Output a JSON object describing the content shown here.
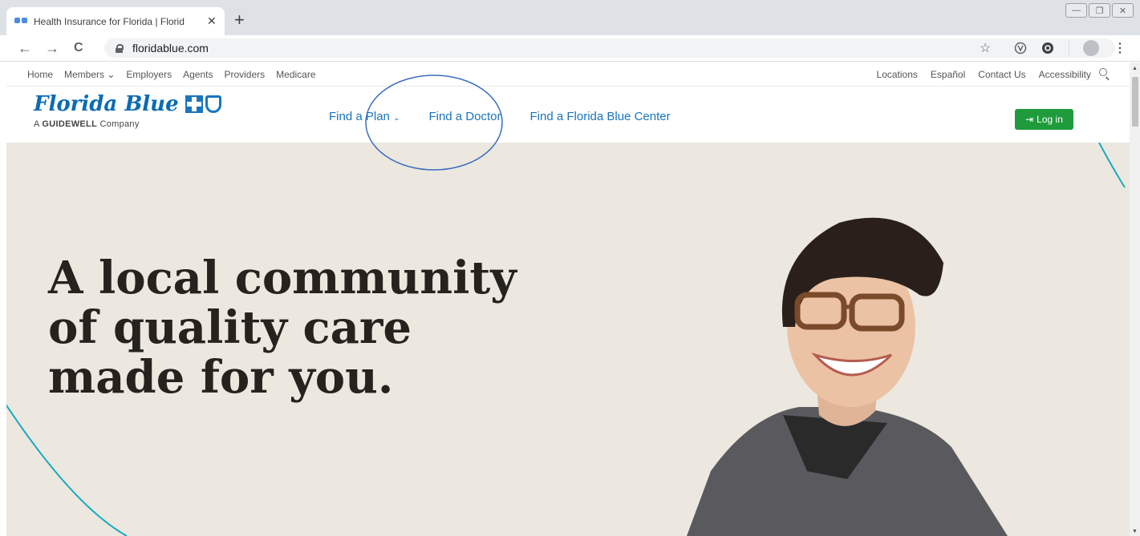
{
  "browser": {
    "tab_title": "Health Insurance for Florida | Florid",
    "tab_close": "✕",
    "new_tab": "+",
    "url": "floridablue.com",
    "back": "←",
    "forward": "→",
    "reload": "C",
    "star": "☆",
    "window": {
      "minimize": "—",
      "restore": "❐",
      "close": "✕"
    },
    "menu": "⋮"
  },
  "utility_nav": {
    "left": [
      "Home",
      "Members ⌄",
      "Employers",
      "Agents",
      "Providers",
      "Medicare"
    ],
    "right": [
      "Locations",
      "Español",
      "Contact Us",
      "Accessibility"
    ]
  },
  "header": {
    "logo": "Florida Blue",
    "tagline_prefix": "A ",
    "tagline_brand": "GUIDEWELL",
    "tagline_suffix": " Company",
    "nav": {
      "find_plan": "Find a Plan",
      "find_doctor": "Find a Doctor",
      "find_center": "Find a Florida Blue Center"
    },
    "login": "Log in"
  },
  "hero": {
    "line1": "A local community",
    "line2": "of quality care",
    "line3": "made for you."
  },
  "colors": {
    "brand_blue": "#0a6bb3",
    "login_green": "#1f9b3c",
    "hero_bg": "#ece8e0",
    "accent_teal": "#1aa9c1"
  }
}
